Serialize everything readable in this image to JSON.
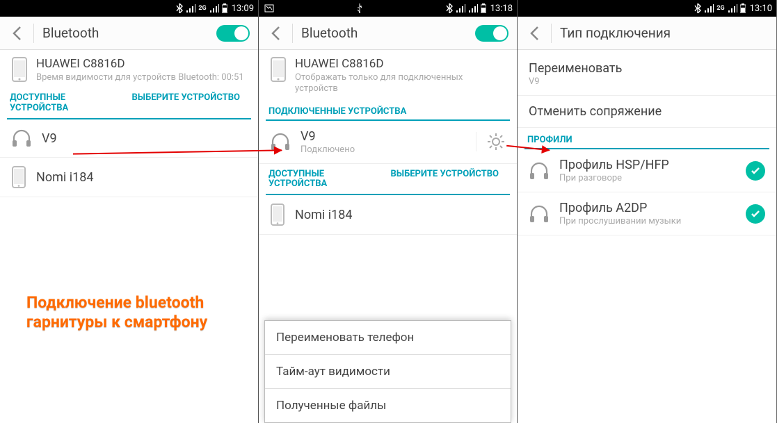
{
  "caption": "Подключение bluetooth\nгарнитуры к смартфону",
  "screens": [
    {
      "status_time": "13:09",
      "header_title": "Bluetooth",
      "toggle_on": true,
      "device_name": "HUAWEI C8816D",
      "device_sub": "Время видимости для устройств Bluetooth: 00:51",
      "tab_left": "ДОСТУПНЫЕ УСТРОЙСТВА",
      "tab_right": "ВЫБЕРИТЕ УСТРОЙСТВО",
      "items": [
        {
          "icon": "headphones",
          "title": "V9"
        },
        {
          "icon": "phone",
          "title": "Nomi i184"
        }
      ]
    },
    {
      "status_time": "13:18",
      "header_title": "Bluetooth",
      "toggle_on": true,
      "device_name": "HUAWEI C8816D",
      "device_sub": "Отображать только для подключенных устройств",
      "section_connected": "ПОДКЛЮЧЕННЫЕ УСТРОЙСТВА",
      "connected_item": {
        "title": "V9",
        "sub": "Подключено"
      },
      "tab_left": "ДОСТУПНЫЕ УСТРОЙСТВА",
      "tab_right": "ВЫБЕРИТЕ УСТРОЙСТВО",
      "items": [
        {
          "icon": "phone",
          "title": "Nomi i184"
        }
      ],
      "menu": [
        "Переименовать телефон",
        "Тайм-аут видимости",
        "Полученные файлы"
      ]
    },
    {
      "status_time": "13:10",
      "header_title": "Тип подключения",
      "rename_label": "Переименовать",
      "rename_value": "V9",
      "unpair_label": "Отменить сопряжение",
      "section_profiles": "ПРОФИЛИ",
      "profiles": [
        {
          "title": "Профиль HSP/HFP",
          "sub": "При разговоре"
        },
        {
          "title": "Профиль A2DP",
          "sub": "При прослушивании музыки"
        }
      ]
    }
  ]
}
